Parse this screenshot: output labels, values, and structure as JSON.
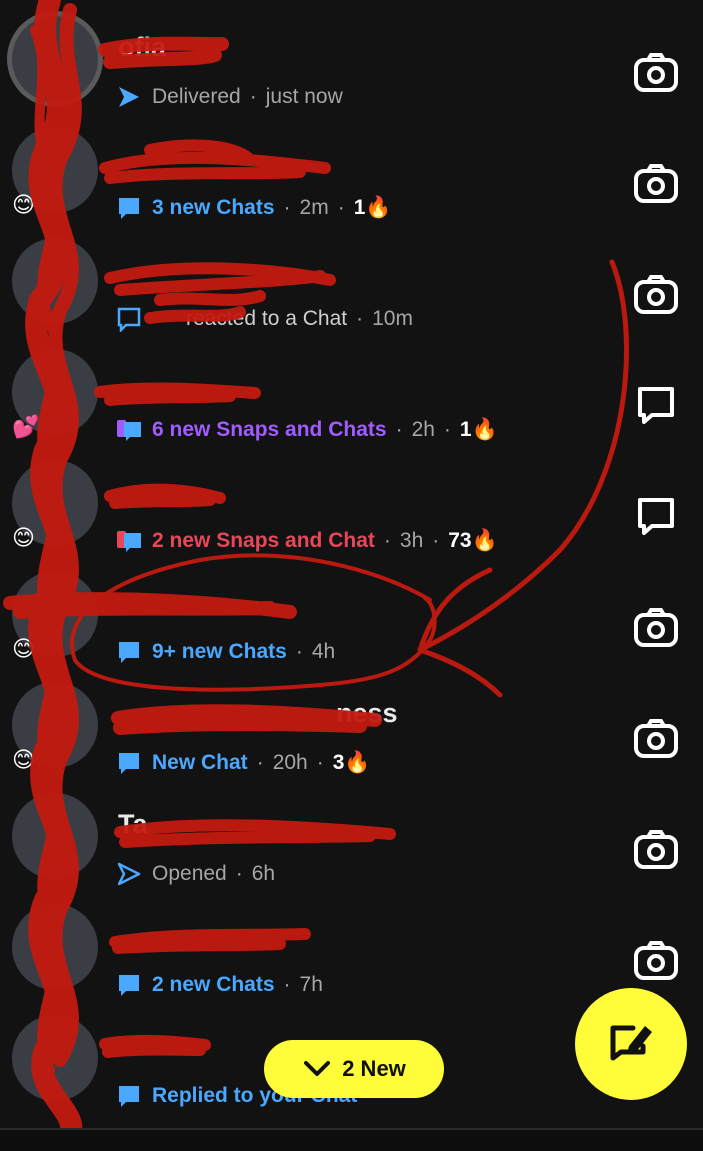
{
  "colors": {
    "background": "#121212",
    "chat_blue": "#4aa8ff",
    "snap_purple": "#a05cff",
    "snap_red": "#e8475a",
    "accent_yellow": "#fffc3a",
    "redaction": "#c41a10"
  },
  "chats": [
    {
      "name": "ofia",
      "status_icon": "sent-arrow-icon",
      "status_label": "Delivered",
      "status_kind": "meta",
      "time": "just now",
      "streak": "",
      "emoji": "",
      "right_icon": "camera-icon"
    },
    {
      "name": "",
      "status_icon": "chat-bubble-icon",
      "status_label": "3 new Chats",
      "status_kind": "chat",
      "time": "2m",
      "streak": "1🔥",
      "emoji": "😊",
      "right_icon": "camera-icon"
    },
    {
      "name": "",
      "status_icon": "chat-outline-icon",
      "status_label": "reacted to a Chat",
      "status_kind": "meta",
      "time": "10m",
      "streak": "",
      "emoji": "",
      "right_icon": "camera-icon"
    },
    {
      "name": "",
      "status_icon": "snap-chat-icon",
      "status_label": "6 new Snaps and Chats",
      "status_kind": "purple",
      "time": "2h",
      "streak": "1🔥",
      "emoji": "💕",
      "right_icon": "chat-bubble-outline-icon"
    },
    {
      "name": "",
      "status_icon": "snap-chat-icon",
      "status_label": "2 new Snaps and Chat",
      "status_kind": "red",
      "time": "3h",
      "streak": "73🔥",
      "emoji": "😊",
      "right_icon": "chat-bubble-outline-icon"
    },
    {
      "name": "",
      "status_icon": "chat-bubble-icon",
      "status_label": "9+ new Chats",
      "status_kind": "chat",
      "time": "4h",
      "streak": "",
      "emoji": "😊",
      "right_icon": "camera-icon"
    },
    {
      "name": "ness",
      "status_icon": "chat-bubble-icon",
      "status_label": "New Chat",
      "status_kind": "chat",
      "time": "20h",
      "streak": "3🔥",
      "emoji": "😊",
      "right_icon": "camera-icon"
    },
    {
      "name": "Ta",
      "status_icon": "opened-arrow-icon",
      "status_label": "Opened",
      "status_kind": "meta",
      "time": "6h",
      "streak": "",
      "emoji": "",
      "right_icon": "camera-icon"
    },
    {
      "name": "",
      "status_icon": "chat-bubble-icon",
      "status_label": "2 new Chats",
      "status_kind": "chat",
      "time": "7h",
      "streak": "",
      "emoji": "",
      "right_icon": "camera-icon"
    },
    {
      "name": "",
      "status_icon": "chat-bubble-icon",
      "status_label": "Replied to your Chat",
      "status_kind": "chat",
      "time": "",
      "streak": "",
      "emoji": "",
      "right_icon": ""
    }
  ],
  "new_pill": {
    "label": "2 New",
    "icon": "chevron-down-icon"
  },
  "fab": {
    "icon": "new-chat-icon"
  }
}
